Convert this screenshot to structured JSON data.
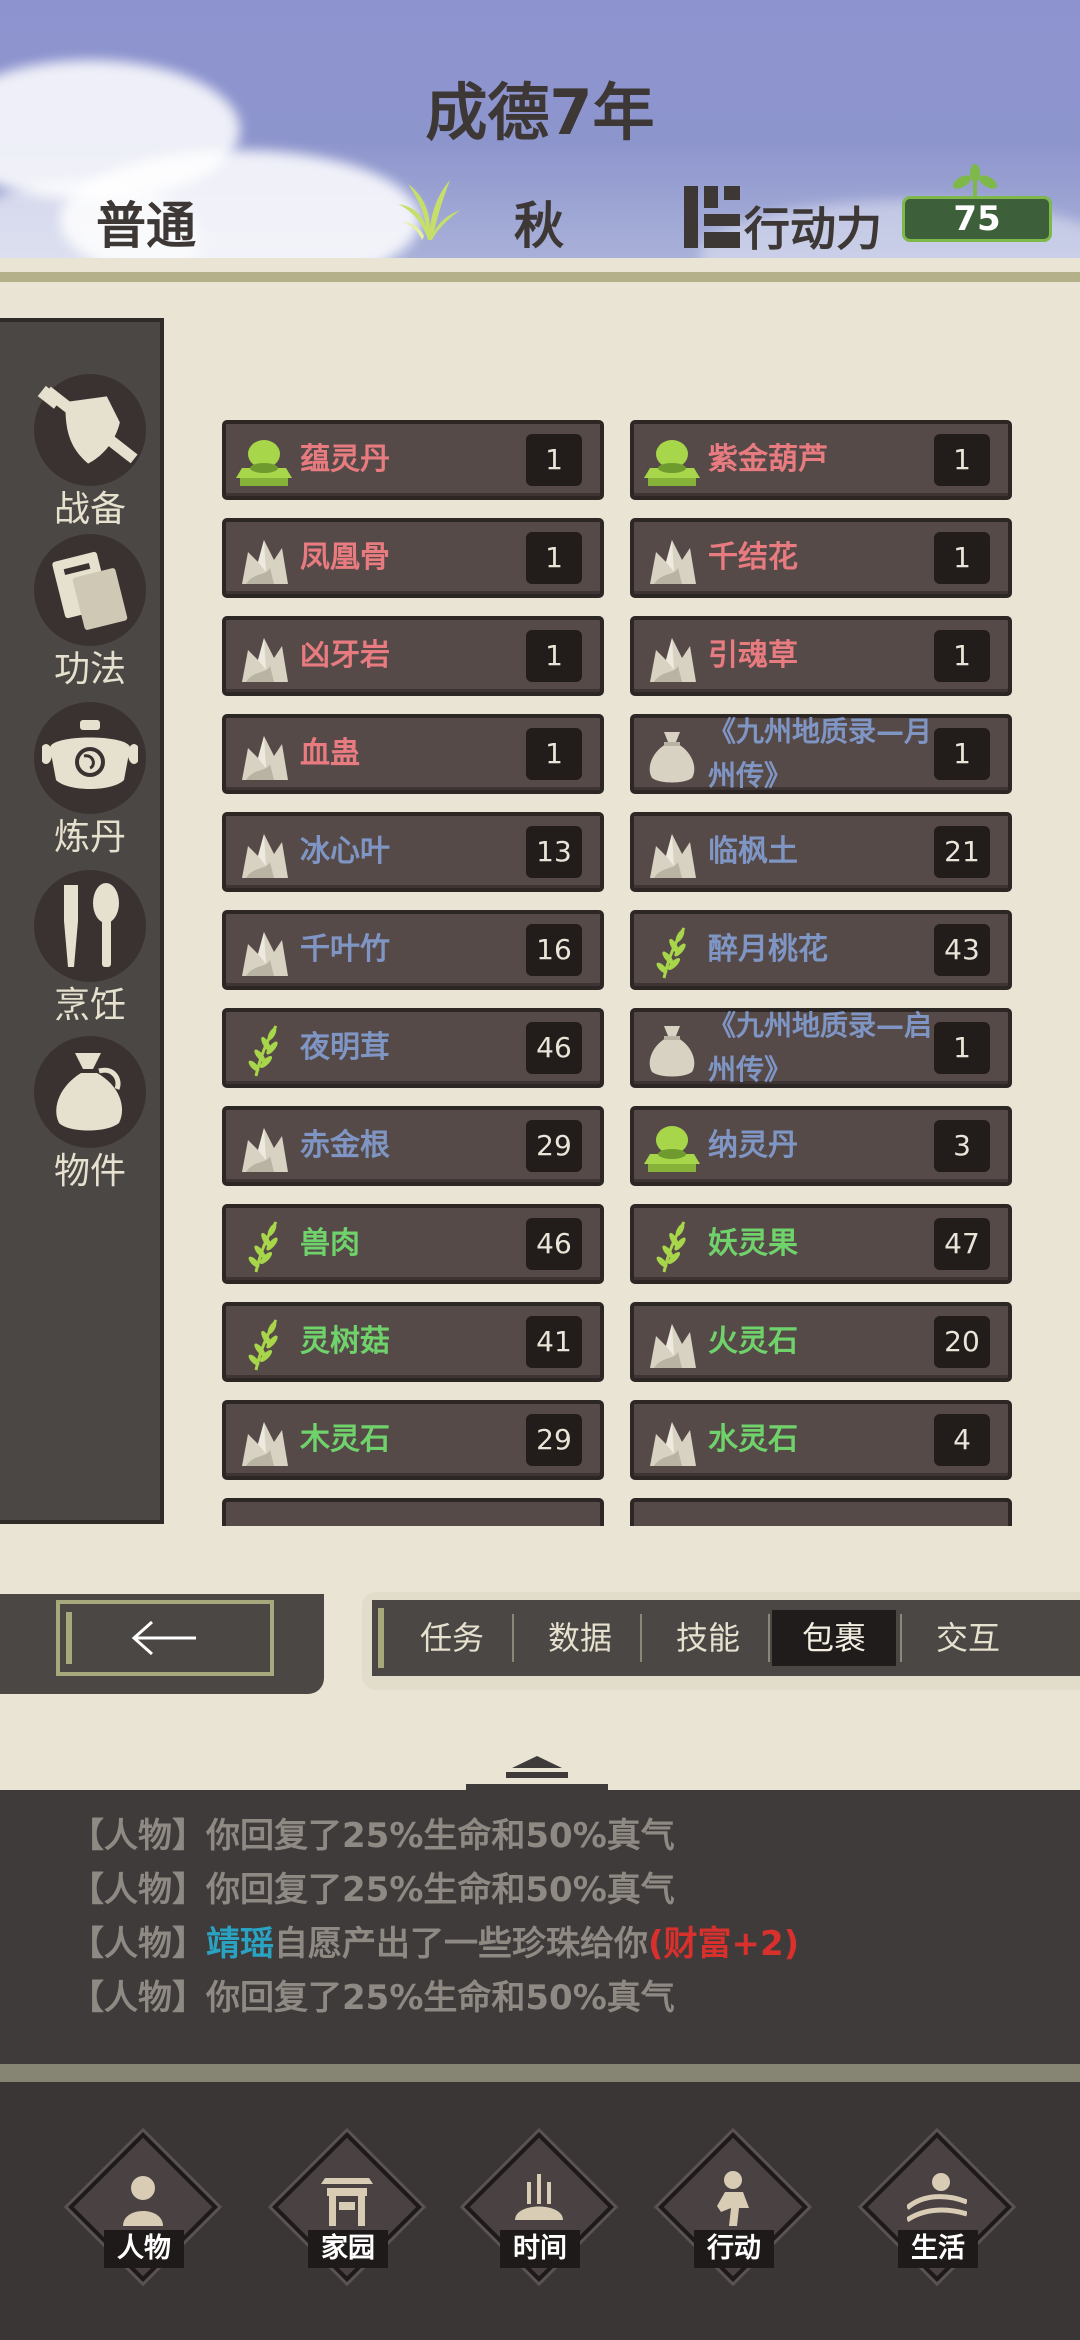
{
  "header": {
    "title": "成德7年",
    "difficulty": "普通",
    "season": "秋",
    "action_points_label": "行动力",
    "action_points_value": "75"
  },
  "sidebar": {
    "categories": [
      {
        "label": "战备",
        "icon": "sword-shield-icon"
      },
      {
        "label": "功法",
        "icon": "book-icon"
      },
      {
        "label": "炼丹",
        "icon": "cauldron-icon"
      },
      {
        "label": "烹饪",
        "icon": "utensils-icon"
      },
      {
        "label": "物件",
        "icon": "pouch-icon"
      }
    ]
  },
  "items": [
    {
      "name": "蕴灵丹",
      "count": "1",
      "color": "#e77b7f",
      "icon": "pill-icon"
    },
    {
      "name": "紫金葫芦",
      "count": "1",
      "color": "#e77b7f",
      "icon": "pill-icon"
    },
    {
      "name": "凤凰骨",
      "count": "1",
      "color": "#e77b7f",
      "icon": "ore-icon"
    },
    {
      "name": "千结花",
      "count": "1",
      "color": "#e77b7f",
      "icon": "ore-icon"
    },
    {
      "name": "凶牙岩",
      "count": "1",
      "color": "#e77b7f",
      "icon": "ore-icon"
    },
    {
      "name": "引魂草",
      "count": "1",
      "color": "#e77b7f",
      "icon": "ore-icon"
    },
    {
      "name": "血蛊",
      "count": "1",
      "color": "#e77b7f",
      "icon": "ore-icon"
    },
    {
      "name": "《九州地质录—月州传》",
      "count": "1",
      "color": "#7f95c4",
      "icon": "pouch-icon"
    },
    {
      "name": "冰心叶",
      "count": "13",
      "color": "#7f95c4",
      "icon": "ore-icon"
    },
    {
      "name": "临枫土",
      "count": "21",
      "color": "#7f95c4",
      "icon": "ore-icon"
    },
    {
      "name": "千叶竹",
      "count": "16",
      "color": "#7f95c4",
      "icon": "ore-icon"
    },
    {
      "name": "醉月桃花",
      "count": "43",
      "color": "#7f95c4",
      "icon": "herb-icon"
    },
    {
      "name": "夜明茸",
      "count": "46",
      "color": "#7f95c4",
      "icon": "herb-icon"
    },
    {
      "name": "《九州地质录—启州传》",
      "count": "1",
      "color": "#7f95c4",
      "icon": "pouch-icon"
    },
    {
      "name": "赤金根",
      "count": "29",
      "color": "#7f95c4",
      "icon": "ore-icon"
    },
    {
      "name": "纳灵丹",
      "count": "3",
      "color": "#7f95c4",
      "icon": "pill-icon"
    },
    {
      "name": "兽肉",
      "count": "46",
      "color": "#6fd26a",
      "icon": "herb-icon"
    },
    {
      "name": "妖灵果",
      "count": "47",
      "color": "#6fd26a",
      "icon": "herb-icon"
    },
    {
      "name": "灵树菇",
      "count": "41",
      "color": "#6fd26a",
      "icon": "herb-icon"
    },
    {
      "name": "火灵石",
      "count": "20",
      "color": "#6fd26a",
      "icon": "ore-icon"
    },
    {
      "name": "木灵石",
      "count": "29",
      "color": "#6fd26a",
      "icon": "ore-icon"
    },
    {
      "name": "水灵石",
      "count": "4",
      "color": "#6fd26a",
      "icon": "ore-icon"
    }
  ],
  "tabs": [
    {
      "label": "任务",
      "active": false
    },
    {
      "label": "数据",
      "active": false
    },
    {
      "label": "技能",
      "active": false
    },
    {
      "label": "包裹",
      "active": true
    },
    {
      "label": "交互",
      "active": false
    }
  ],
  "back_button_icon": "arrow-left-icon",
  "log": [
    {
      "prefix": "【人物】",
      "text": "你回复了25%生命和50%真气"
    },
    {
      "prefix": "【人物】",
      "text": "你回复了25%生命和50%真气"
    },
    {
      "prefix": "【人物】",
      "npc": "靖瑶",
      "text": "自愿产出了一些珍珠给你",
      "highlight": "(财富+2)"
    },
    {
      "prefix": "【人物】",
      "text": "你回复了25%生命和50%真气"
    }
  ],
  "bottom_nav": [
    {
      "label": "人物",
      "icon": "person-icon"
    },
    {
      "label": "家园",
      "icon": "gate-icon"
    },
    {
      "label": "时间",
      "icon": "hourglass-icon"
    },
    {
      "label": "行动",
      "icon": "runner-icon"
    },
    {
      "label": "生活",
      "icon": "landscape-icon"
    }
  ]
}
